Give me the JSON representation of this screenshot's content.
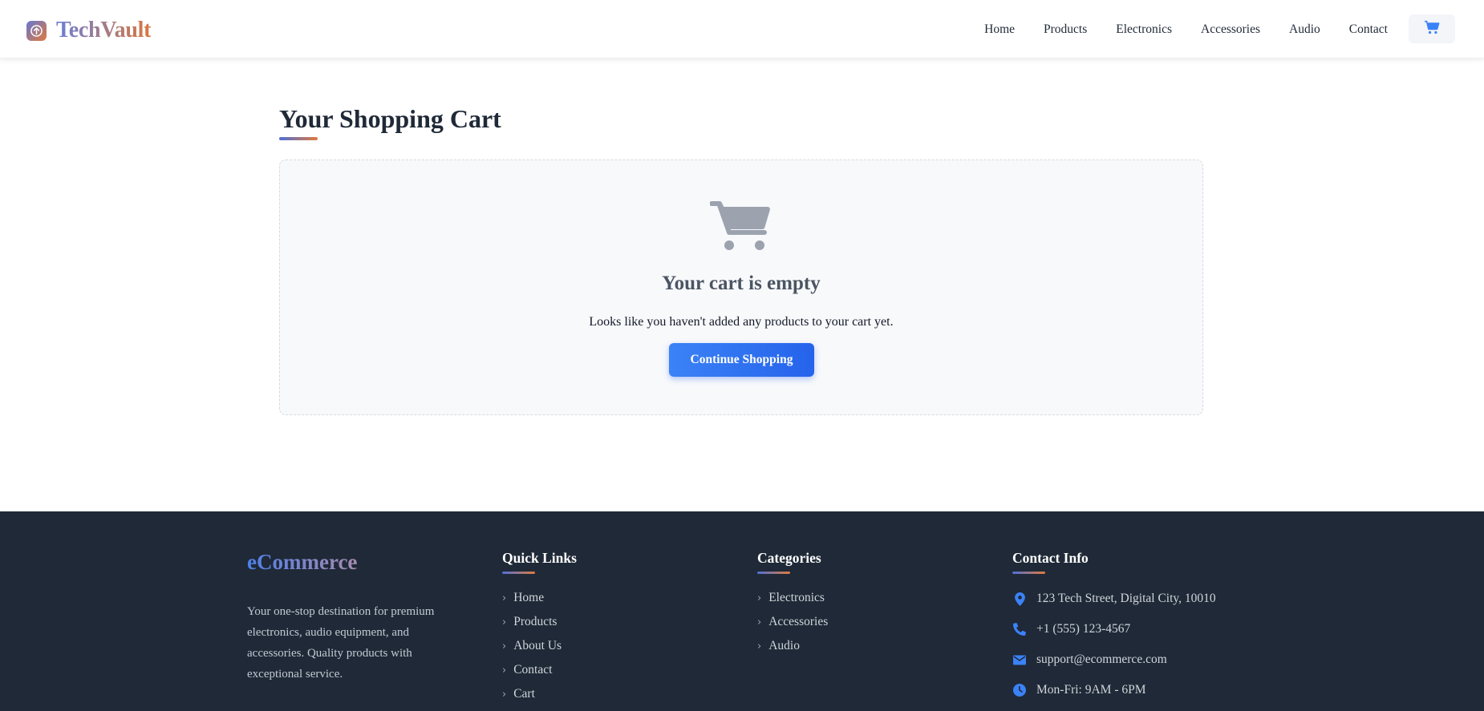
{
  "header": {
    "brand": "TechVault",
    "nav": [
      "Home",
      "Products",
      "Electronics",
      "Accessories",
      "Audio",
      "Contact"
    ],
    "cart_icon": "shopping-cart-icon"
  },
  "main": {
    "title": "Your Shopping Cart",
    "empty_icon": "shopping-cart-icon",
    "empty_title": "Your cart is empty",
    "empty_text": "Looks like you haven't added any products to your cart yet.",
    "continue_label": "Continue Shopping"
  },
  "footer": {
    "brand": "eCommerce",
    "description": "Your one-stop destination for premium electronics, audio equipment, and accessories. Quality products with exceptional service.",
    "quick_links": {
      "title": "Quick Links",
      "items": [
        "Home",
        "Products",
        "About Us",
        "Contact",
        "Cart"
      ]
    },
    "categories": {
      "title": "Categories",
      "items": [
        "Electronics",
        "Accessories",
        "Audio"
      ]
    },
    "contact": {
      "title": "Contact Info",
      "address": "123 Tech Street, Digital City, 10010",
      "phone": "+1 (555) 123-4567",
      "email": "support@ecommerce.com",
      "hours": "Mon-Fri: 9AM - 6PM"
    }
  },
  "colors": {
    "accent": "#3b82f6",
    "accent_dark": "#2563eb",
    "brand_orange": "#e07a3e",
    "footer_bg": "#1f2937",
    "empty_icon": "#9ca3af"
  }
}
